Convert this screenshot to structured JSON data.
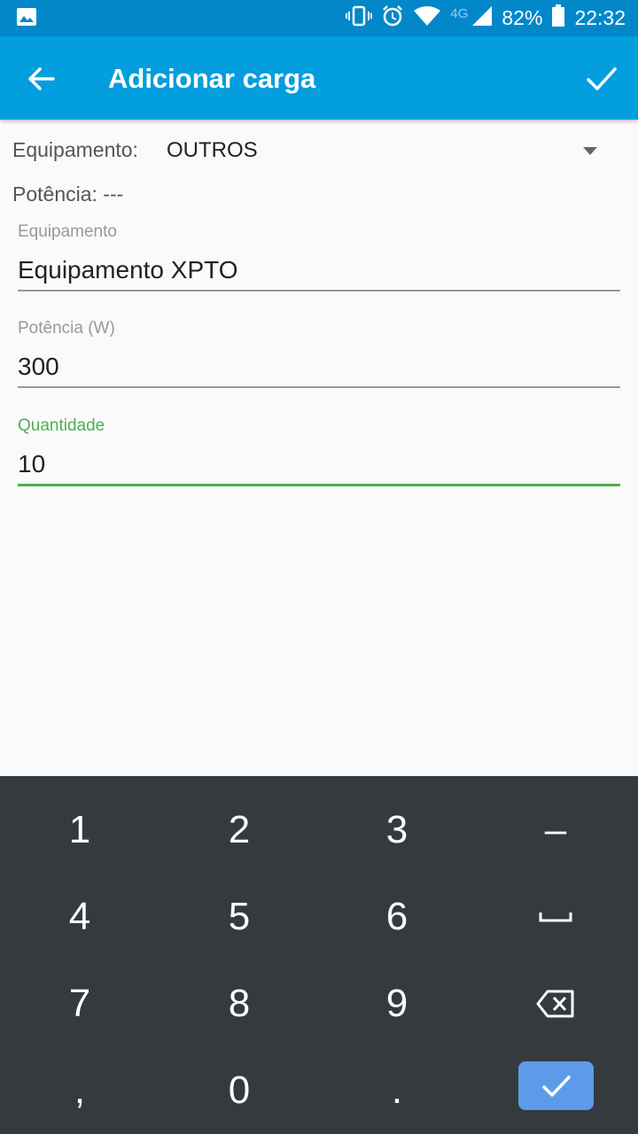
{
  "status_bar": {
    "battery": "82%",
    "time": "22:32",
    "network": "4G"
  },
  "app_bar": {
    "title": "Adicionar carga"
  },
  "form": {
    "equipment_label": "Equipamento:",
    "equipment_value": "OUTROS",
    "power_line": "Potência: ---",
    "fields": [
      {
        "label": "Equipamento",
        "value": "Equipamento XPTO"
      },
      {
        "label": "Potência (W)",
        "value": "300"
      },
      {
        "label": "Quantidade",
        "value": "10"
      }
    ]
  },
  "keyboard": {
    "keys": [
      "1",
      "2",
      "3",
      "–",
      "4",
      "5",
      "6",
      "␣",
      "7",
      "8",
      "9",
      "⌫",
      ",",
      "0",
      ".",
      "✓"
    ],
    "done_color": "#5d9be9"
  },
  "colors": {
    "status_bar": "#0288c9",
    "app_bar": "#039ede",
    "focus": "#4caf50",
    "keyboard_bg": "#353a3f"
  }
}
